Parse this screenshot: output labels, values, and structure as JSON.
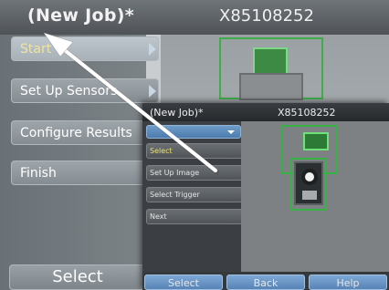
{
  "background_screen": {
    "title": "(New Job)*",
    "serial": "X85108252",
    "sidebar_items": [
      {
        "label": "Start",
        "chevron": true,
        "active": true
      },
      {
        "label": "Set Up Sensors",
        "chevron": true,
        "active": false
      },
      {
        "label": "Configure Results",
        "chevron": false,
        "active": false
      },
      {
        "label": "Finish",
        "chevron": false,
        "active": false
      }
    ],
    "select_label": "Select"
  },
  "foreground_screen": {
    "title": "(New Job)*",
    "serial": "X85108252",
    "dropdown_value": "",
    "menu_items": [
      {
        "label": "Select",
        "active": true
      },
      {
        "label": "Set Up Image",
        "active": false
      },
      {
        "label": "Select Trigger",
        "active": false
      },
      {
        "label": "Next",
        "active": false
      }
    ],
    "buttons": [
      "Select",
      "Back",
      "Help"
    ]
  },
  "colors": {
    "accent_green": "#38b146",
    "button_blue": "#5783b6",
    "arrow": "#ffffff"
  }
}
